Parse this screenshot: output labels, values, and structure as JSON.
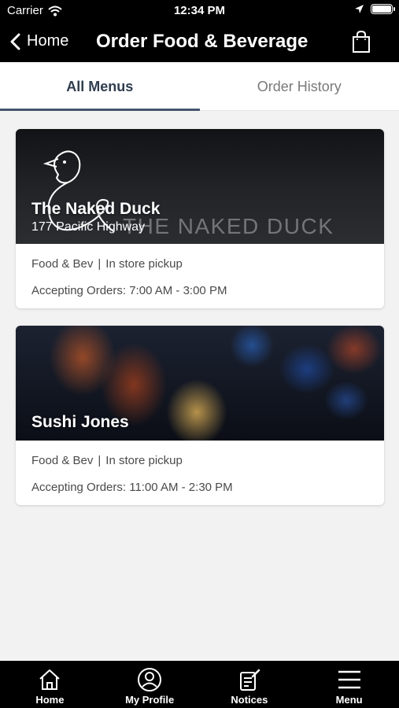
{
  "status_bar": {
    "carrier": "Carrier",
    "time": "12:34 PM"
  },
  "nav": {
    "back_label": "Home",
    "title": "Order Food & Beverage"
  },
  "tabs": [
    {
      "label": "All Menus",
      "active": true
    },
    {
      "label": "Order History",
      "active": false
    }
  ],
  "venues": [
    {
      "name": "The Naked Duck",
      "address": "177 Pacific Highway",
      "brand_text": "THE NAKED DUCK",
      "category": "Food & Bev",
      "service": "In store pickup",
      "separator": "|",
      "hours": "Accepting Orders: 7:00 AM - 3:00 PM"
    },
    {
      "name": "Sushi Jones",
      "category": "Food & Bev",
      "service": "In store pickup",
      "separator": "|",
      "hours": "Accepting Orders: 11:00 AM - 2:30 PM"
    }
  ],
  "bottom_nav": [
    {
      "label": "Home",
      "icon": "home-icon"
    },
    {
      "label": "My Profile",
      "icon": "profile-icon"
    },
    {
      "label": "Notices",
      "icon": "notices-icon"
    },
    {
      "label": "Menu",
      "icon": "hamburger-icon"
    }
  ],
  "colors": {
    "bar_background": "#000000",
    "page_background": "#f2f2f2",
    "active_tab": "#2f3d4f",
    "tab_indicator": "#44566c"
  }
}
